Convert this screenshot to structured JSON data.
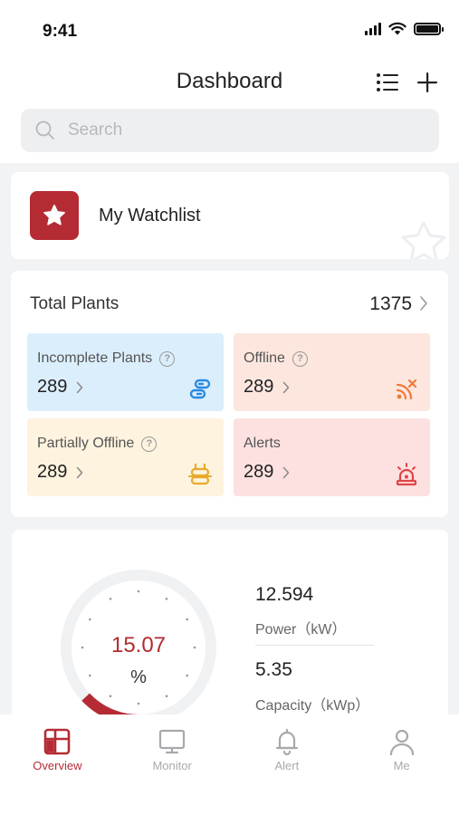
{
  "status_bar": {
    "time": "9:41"
  },
  "header": {
    "title": "Dashboard",
    "list_icon": "list-icon",
    "add_icon": "plus-icon"
  },
  "search": {
    "placeholder": "Search",
    "value": ""
  },
  "watchlist": {
    "label": "My Watchlist",
    "icon": "star-icon"
  },
  "plants": {
    "total_label": "Total Plants",
    "total_value": "1375",
    "tiles": [
      {
        "label": "Incomplete Plants",
        "value": "289",
        "has_help": true,
        "icon": "link-icon",
        "bg": "#dbeefc",
        "icon_color": "#2b8ae0"
      },
      {
        "label": "Offline",
        "value": "289",
        "has_help": true,
        "icon": "signal-off-icon",
        "bg": "#fce6de",
        "icon_color": "#ef7a3a"
      },
      {
        "label": "Partially Offline",
        "value": "289",
        "has_help": true,
        "icon": "partial-link-icon",
        "bg": "#fdf3de",
        "icon_color": "#e8a92b"
      },
      {
        "label": "Alerts",
        "value": "289",
        "has_help": false,
        "icon": "alarm-icon",
        "bg": "#fde1e1",
        "icon_color": "#e04448"
      }
    ]
  },
  "metrics": {
    "gauge_value": "15.07",
    "gauge_unit": "%",
    "gauge_percent": 15.07,
    "power_value": "12.594",
    "power_label": "Power（kW）",
    "capacity_value": "5.35",
    "capacity_label": "Capacity（kWp）"
  },
  "tabs": [
    {
      "label": "Overview",
      "icon": "overview-icon",
      "active": true
    },
    {
      "label": "Monitor",
      "icon": "monitor-icon",
      "active": false
    },
    {
      "label": "Alert",
      "icon": "bell-icon",
      "active": false
    },
    {
      "label": "Me",
      "icon": "user-icon",
      "active": false
    }
  ],
  "colors": {
    "brand": "#b52b34",
    "page_bg": "#f2f3f5",
    "inactive_tab": "#a7a9ad"
  }
}
